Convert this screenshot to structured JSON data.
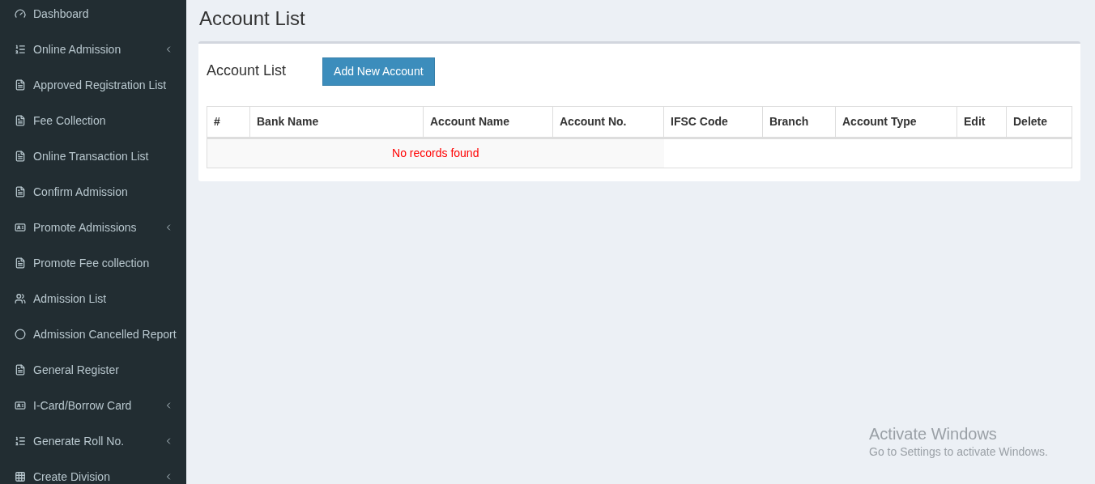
{
  "sidebar": {
    "items": [
      {
        "label": "Dashboard",
        "kind": "dashboard",
        "submenu": false
      },
      {
        "label": "Online Admission",
        "kind": "list",
        "submenu": true
      },
      {
        "label": "Approved Registration List",
        "kind": "document",
        "submenu": false
      },
      {
        "label": "Fee Collection",
        "kind": "document",
        "submenu": false
      },
      {
        "label": "Online Transaction List",
        "kind": "document",
        "submenu": false
      },
      {
        "label": "Confirm Admission",
        "kind": "document",
        "submenu": false
      },
      {
        "label": "Promote Admissions",
        "kind": "card",
        "submenu": true
      },
      {
        "label": "Promote Fee collection",
        "kind": "document",
        "submenu": false
      },
      {
        "label": "Admission List",
        "kind": "users",
        "submenu": false
      },
      {
        "label": "Admission Cancelled Report",
        "kind": "circle",
        "submenu": false
      },
      {
        "label": "General Register",
        "kind": "document",
        "submenu": false
      },
      {
        "label": "I-Card/Borrow Card",
        "kind": "card",
        "submenu": true
      },
      {
        "label": "Generate Roll No.",
        "kind": "list",
        "submenu": true
      },
      {
        "label": "Create Division",
        "kind": "grid",
        "submenu": true
      }
    ]
  },
  "page_title": "Account List",
  "panel": {
    "title": "Account List",
    "button": "Add New Account",
    "table": {
      "columns": [
        "#",
        "Bank Name",
        "Account Name",
        "Account No.",
        "IFSC Code",
        "Branch",
        "Account Type",
        "Edit",
        "Delete"
      ],
      "empty_message": "No records found"
    }
  },
  "os_notice": {
    "title": "Activate Windows",
    "subtitle": "Go to Settings to activate Windows."
  }
}
